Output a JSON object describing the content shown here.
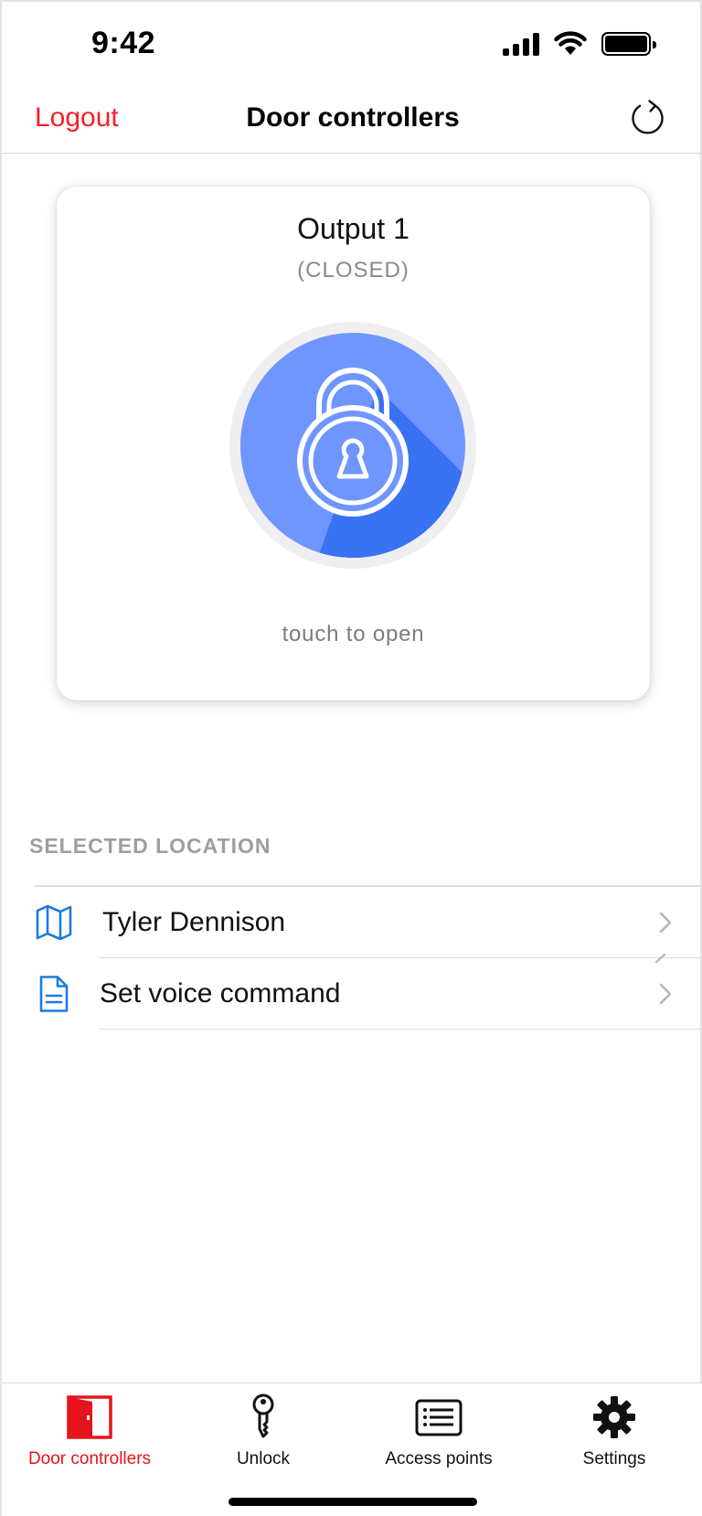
{
  "status_bar": {
    "time": "9:42",
    "icons": [
      "cellular-signal-icon",
      "wifi-icon",
      "battery-icon"
    ]
  },
  "nav": {
    "logout_label": "Logout",
    "title": "Door controllers",
    "refresh_icon": "refresh-icon"
  },
  "card": {
    "output_name": "Output 1",
    "output_status": "(CLOSED)",
    "lock_icon": "padlock-icon",
    "hint": "touch to open"
  },
  "section": {
    "header": "SELECTED LOCATION",
    "rows": [
      {
        "icon": "map-icon",
        "label": "Tyler Dennison"
      },
      {
        "icon": "document-icon",
        "label": "Set voice command"
      }
    ]
  },
  "tab_bar": {
    "tabs": [
      {
        "icon": "door-icon",
        "label": "Door controllers",
        "active": true
      },
      {
        "icon": "key-icon",
        "label": "Unlock",
        "active": false
      },
      {
        "icon": "list-icon",
        "label": "Access points",
        "active": false
      },
      {
        "icon": "gear-icon",
        "label": "Settings",
        "active": false
      }
    ]
  },
  "colors": {
    "accent_red": "#f5202a",
    "lock_blue": "#6f95ff",
    "lock_blue_shadow": "#3a72f4",
    "icon_blue": "#1a7be0"
  }
}
